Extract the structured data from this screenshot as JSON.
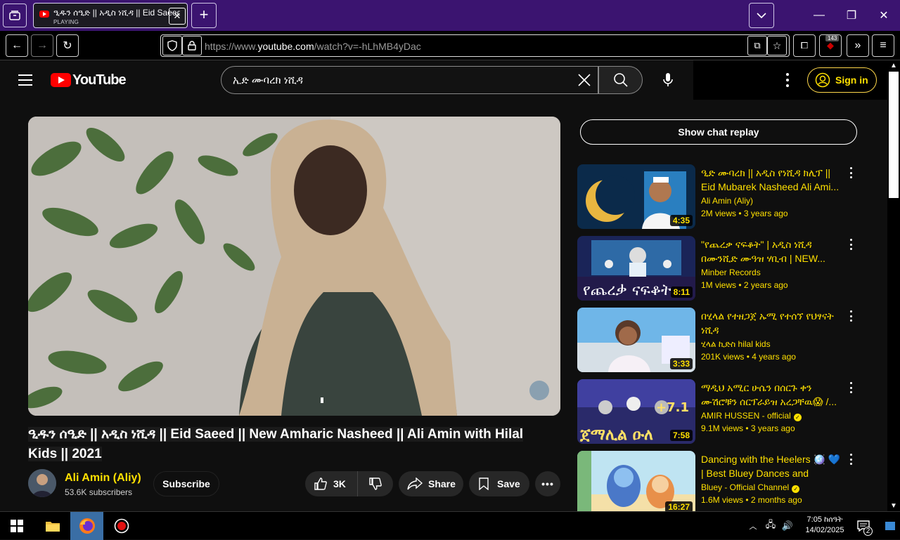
{
  "browser": {
    "tab": {
      "title": "ዒዱን ሰዒድ || አዲስ ነሺዳ || Eid Saeed",
      "status": "PLAYING"
    },
    "url_prefix": "https://www.",
    "url_domain": "youtube.com",
    "url_path": "/watch?v=-hLhMB4yDac",
    "ext_badge": "143"
  },
  "youtube": {
    "logo_text": "YouTube",
    "search_value": "ኢድ ሙባረክ ነሺዳ",
    "sign_in": "Sign in"
  },
  "video": {
    "title": "ዒዱን ሰዒድ || አዲስ ነሺዳ || Eid Saeed || New Amharic Nasheed || Ali Amin with Hilal Kids || 2021",
    "channel": "Ali Amin (Aliy)",
    "subscribers": "53.6K subscribers",
    "subscribe": "Subscribe",
    "likes": "3K",
    "share": "Share",
    "save": "Save"
  },
  "sidebar": {
    "chat_replay": "Show chat replay",
    "recs": [
      {
        "title": "ዒድ ሙባረክ || አዲስ የነሺዳ ክሊፕ || Eid Mubarek Nasheed Ali Ami...",
        "channel": "Ali Amin (Aliy)",
        "views": "2M views",
        "age": "3 years ago",
        "duration": "4:35",
        "verified": false
      },
      {
        "title": "\"የጨረቃ ናፍቆት\" | አዲስ ነሺዳ በሙንሺድ ሙዓዝ ሃቢብ | NEW...",
        "channel": "Minber Records",
        "views": "1M views",
        "age": "2 years ago",
        "duration": "8:11",
        "verified": false
      },
      {
        "title": "በሂላል የተዘጋጀ ኡሚ የተሰኘ የህፃናት ነሺዳ",
        "channel": "ሂላል ኪድስ hilal kids",
        "views": "201K views",
        "age": "4 years ago",
        "duration": "3:33",
        "verified": false
      },
      {
        "title": "ማዲህ አሚር ሁሴን በሰርጉ ቀን ሙሽሮቹን ሰርፕራይዝ አረጋቸዉ😱 /...",
        "channel": "AMIR HUSSEN - official",
        "views": "9.1M views",
        "age": "3 years ago",
        "duration": "7:58",
        "verified": true
      },
      {
        "title": "Dancing with the Heelers 🪩 💙 | Best Bluey Dances and More!...",
        "channel": "Bluey - Official Channel",
        "views": "1.6M views",
        "age": "2 months ago",
        "duration": "16:27",
        "verified": true
      }
    ]
  },
  "taskbar": {
    "time": "7:05 ከሰዓት",
    "date": "14/02/2025",
    "notif_count": "2"
  }
}
